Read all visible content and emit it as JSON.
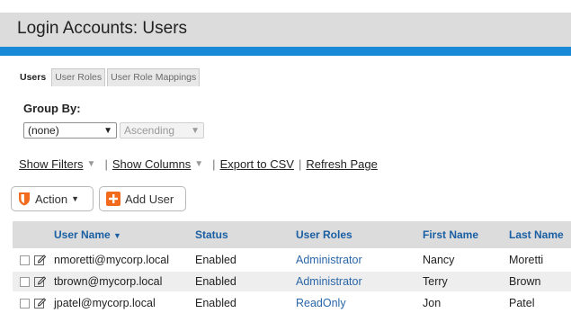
{
  "page": {
    "title": "Login Accounts: Users"
  },
  "tabs": [
    {
      "label": "Users",
      "active": true
    },
    {
      "label": "User Roles",
      "active": false
    },
    {
      "label": "User Role Mappings",
      "active": false
    }
  ],
  "group_by": {
    "label": "Group By:",
    "value": "(none)",
    "order_value": "Ascending"
  },
  "links": {
    "show_filters": "Show Filters",
    "show_columns": "Show Columns",
    "export_csv": "Export to CSV",
    "refresh": "Refresh Page"
  },
  "toolbar": {
    "action_label": "Action",
    "add_user_label": "Add User"
  },
  "table": {
    "columns": [
      "User Name",
      "Status",
      "User Roles",
      "First Name",
      "Last Name"
    ],
    "rows": [
      {
        "user_name": "nmoretti@mycorp.local",
        "status": "Enabled",
        "role": "Administrator",
        "first": "Nancy",
        "last": "Moretti"
      },
      {
        "user_name": "tbrown@mycorp.local",
        "status": "Enabled",
        "role": "Administrator",
        "first": "Terry",
        "last": "Brown"
      },
      {
        "user_name": "jpatel@mycorp.local",
        "status": "Enabled",
        "role": "ReadOnly",
        "first": "Jon",
        "last": "Patel"
      }
    ]
  },
  "colors": {
    "accent": "#1889d6",
    "link_blue": "#1a5fa3",
    "action_orange": "#f26b1d"
  }
}
